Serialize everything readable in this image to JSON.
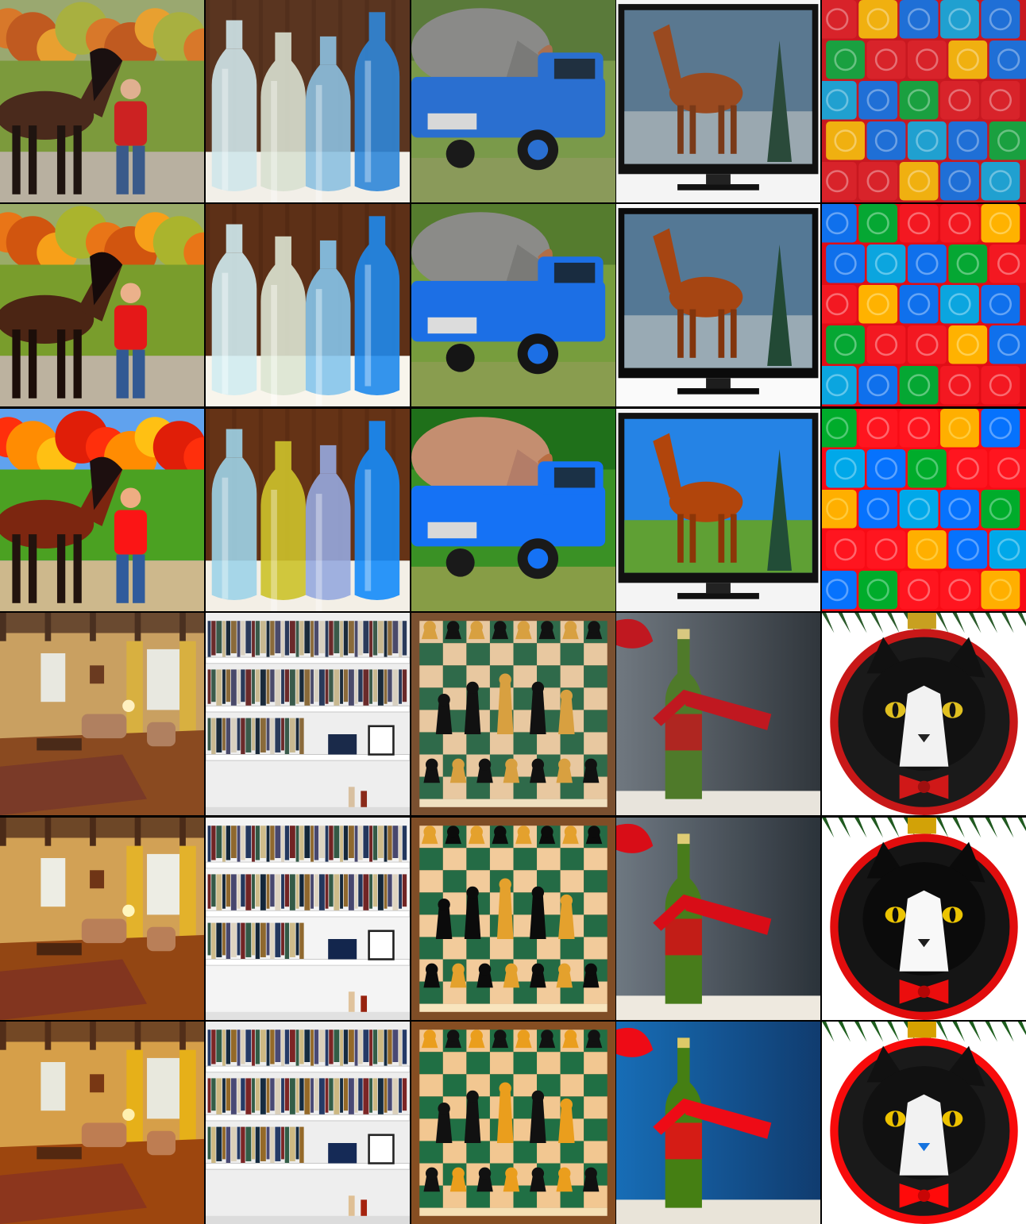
{
  "grid": {
    "columns": 5,
    "rows": 6,
    "tiles": [
      {
        "subject": "horse-with-man-autumn",
        "style": "photo"
      },
      {
        "subject": "glass-bottles",
        "style": "photo"
      },
      {
        "subject": "rhino-in-blue-pickup-truck",
        "style": "photo"
      },
      {
        "subject": "horse-on-tv-screen",
        "style": "photo"
      },
      {
        "subject": "colorful-toy-blocks",
        "style": "photo"
      },
      {
        "subject": "horse-with-man-autumn",
        "style": "soft"
      },
      {
        "subject": "glass-bottles",
        "style": "soft"
      },
      {
        "subject": "rhino-in-blue-pickup-truck",
        "style": "soft"
      },
      {
        "subject": "horse-on-tv-screen",
        "style": "soft"
      },
      {
        "subject": "colorful-toy-blocks",
        "style": "soft"
      },
      {
        "subject": "horse-with-man-autumn",
        "style": "anime"
      },
      {
        "subject": "glass-bottles",
        "style": "anime"
      },
      {
        "subject": "rhino-in-blue-pickup-truck",
        "style": "anime"
      },
      {
        "subject": "horse-on-tv-screen",
        "style": "anime"
      },
      {
        "subject": "colorful-toy-blocks",
        "style": "anime"
      },
      {
        "subject": "living-room",
        "style": "photo"
      },
      {
        "subject": "bookshelf",
        "style": "photo"
      },
      {
        "subject": "chess-pieces",
        "style": "photo"
      },
      {
        "subject": "wine-bottle-red-ribbon",
        "style": "photo"
      },
      {
        "subject": "tuxedo-cat-ornament",
        "style": "photo"
      },
      {
        "subject": "living-room",
        "style": "soft"
      },
      {
        "subject": "bookshelf",
        "style": "soft"
      },
      {
        "subject": "chess-pieces",
        "style": "soft"
      },
      {
        "subject": "wine-bottle-red-ribbon",
        "style": "soft"
      },
      {
        "subject": "tuxedo-cat-ornament",
        "style": "soft"
      },
      {
        "subject": "living-room",
        "style": "anime"
      },
      {
        "subject": "bookshelf",
        "style": "anime"
      },
      {
        "subject": "chess-pieces",
        "style": "anime"
      },
      {
        "subject": "wine-bottle-red-ribbon",
        "style": "anime"
      },
      {
        "subject": "tuxedo-cat-ornament",
        "style": "anime"
      }
    ]
  },
  "colors": {
    "background": "#000000",
    "autumn_orange": "#d8782a",
    "grass_green": "#7c9a3c",
    "horse_brown": "#4a2a1c",
    "shirt_red": "#cc2222",
    "truck_blue": "#2a6fd0",
    "rhino_gray": "#8a8a88",
    "bottle_blue": "#2f86d8",
    "wood_brown": "#5a3520",
    "tv_black": "#111111",
    "block_red": "#d8232a",
    "block_blue": "#1f6fd6",
    "wall_tan": "#c9a061",
    "shelf_white": "#eeeeee",
    "chess_green": "#2f6a4a",
    "ribbon_red": "#c01820",
    "wine_green": "#4f7a2a",
    "cat_black": "#111111",
    "ornament_red": "#c81818",
    "bowtie_red": "#d01818",
    "eye_yellow": "#e0c020"
  }
}
